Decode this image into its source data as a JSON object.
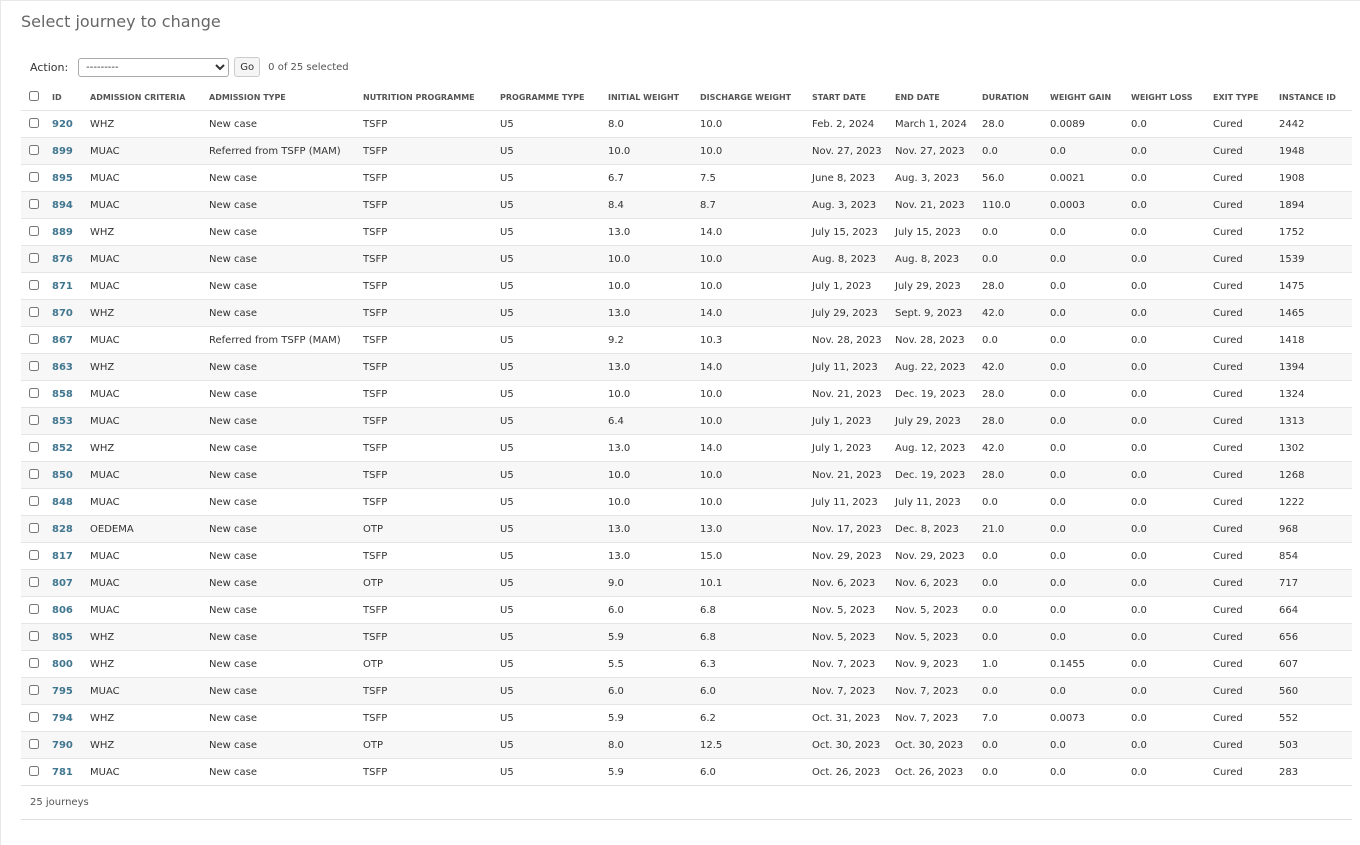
{
  "page": {
    "title": "Select journey to change"
  },
  "actions": {
    "label": "Action:",
    "select_value": "---------",
    "go_label": "Go",
    "counter": "0 of 25 selected"
  },
  "table": {
    "columns": [
      "ID",
      "Admission criteria",
      "Admission type",
      "Nutrition programme",
      "Programme type",
      "Initial weight",
      "Discharge weight",
      "Start date",
      "End date",
      "Duration",
      "Weight gain",
      "Weight loss",
      "Exit type",
      "Instance ID"
    ],
    "rows": [
      [
        "920",
        "WHZ",
        "New case",
        "TSFP",
        "U5",
        "8.0",
        "10.0",
        "Feb. 2, 2024",
        "March 1, 2024",
        "28.0",
        "0.0089",
        "0.0",
        "Cured",
        "2442"
      ],
      [
        "899",
        "MUAC",
        "Referred from TSFP (MAM)",
        "TSFP",
        "U5",
        "10.0",
        "10.0",
        "Nov. 27, 2023",
        "Nov. 27, 2023",
        "0.0",
        "0.0",
        "0.0",
        "Cured",
        "1948"
      ],
      [
        "895",
        "MUAC",
        "New case",
        "TSFP",
        "U5",
        "6.7",
        "7.5",
        "June 8, 2023",
        "Aug. 3, 2023",
        "56.0",
        "0.0021",
        "0.0",
        "Cured",
        "1908"
      ],
      [
        "894",
        "MUAC",
        "New case",
        "TSFP",
        "U5",
        "8.4",
        "8.7",
        "Aug. 3, 2023",
        "Nov. 21, 2023",
        "110.0",
        "0.0003",
        "0.0",
        "Cured",
        "1894"
      ],
      [
        "889",
        "WHZ",
        "New case",
        "TSFP",
        "U5",
        "13.0",
        "14.0",
        "July 15, 2023",
        "July 15, 2023",
        "0.0",
        "0.0",
        "0.0",
        "Cured",
        "1752"
      ],
      [
        "876",
        "MUAC",
        "New case",
        "TSFP",
        "U5",
        "10.0",
        "10.0",
        "Aug. 8, 2023",
        "Aug. 8, 2023",
        "0.0",
        "0.0",
        "0.0",
        "Cured",
        "1539"
      ],
      [
        "871",
        "MUAC",
        "New case",
        "TSFP",
        "U5",
        "10.0",
        "10.0",
        "July 1, 2023",
        "July 29, 2023",
        "28.0",
        "0.0",
        "0.0",
        "Cured",
        "1475"
      ],
      [
        "870",
        "WHZ",
        "New case",
        "TSFP",
        "U5",
        "13.0",
        "14.0",
        "July 29, 2023",
        "Sept. 9, 2023",
        "42.0",
        "0.0",
        "0.0",
        "Cured",
        "1465"
      ],
      [
        "867",
        "MUAC",
        "Referred from TSFP (MAM)",
        "TSFP",
        "U5",
        "9.2",
        "10.3",
        "Nov. 28, 2023",
        "Nov. 28, 2023",
        "0.0",
        "0.0",
        "0.0",
        "Cured",
        "1418"
      ],
      [
        "863",
        "WHZ",
        "New case",
        "TSFP",
        "U5",
        "13.0",
        "14.0",
        "July 11, 2023",
        "Aug. 22, 2023",
        "42.0",
        "0.0",
        "0.0",
        "Cured",
        "1394"
      ],
      [
        "858",
        "MUAC",
        "New case",
        "TSFP",
        "U5",
        "10.0",
        "10.0",
        "Nov. 21, 2023",
        "Dec. 19, 2023",
        "28.0",
        "0.0",
        "0.0",
        "Cured",
        "1324"
      ],
      [
        "853",
        "MUAC",
        "New case",
        "TSFP",
        "U5",
        "6.4",
        "10.0",
        "July 1, 2023",
        "July 29, 2023",
        "28.0",
        "0.0",
        "0.0",
        "Cured",
        "1313"
      ],
      [
        "852",
        "WHZ",
        "New case",
        "TSFP",
        "U5",
        "13.0",
        "14.0",
        "July 1, 2023",
        "Aug. 12, 2023",
        "42.0",
        "0.0",
        "0.0",
        "Cured",
        "1302"
      ],
      [
        "850",
        "MUAC",
        "New case",
        "TSFP",
        "U5",
        "10.0",
        "10.0",
        "Nov. 21, 2023",
        "Dec. 19, 2023",
        "28.0",
        "0.0",
        "0.0",
        "Cured",
        "1268"
      ],
      [
        "848",
        "MUAC",
        "New case",
        "TSFP",
        "U5",
        "10.0",
        "10.0",
        "July 11, 2023",
        "July 11, 2023",
        "0.0",
        "0.0",
        "0.0",
        "Cured",
        "1222"
      ],
      [
        "828",
        "OEDEMA",
        "New case",
        "OTP",
        "U5",
        "13.0",
        "13.0",
        "Nov. 17, 2023",
        "Dec. 8, 2023",
        "21.0",
        "0.0",
        "0.0",
        "Cured",
        "968"
      ],
      [
        "817",
        "MUAC",
        "New case",
        "TSFP",
        "U5",
        "13.0",
        "15.0",
        "Nov. 29, 2023",
        "Nov. 29, 2023",
        "0.0",
        "0.0",
        "0.0",
        "Cured",
        "854"
      ],
      [
        "807",
        "MUAC",
        "New case",
        "OTP",
        "U5",
        "9.0",
        "10.1",
        "Nov. 6, 2023",
        "Nov. 6, 2023",
        "0.0",
        "0.0",
        "0.0",
        "Cured",
        "717"
      ],
      [
        "806",
        "MUAC",
        "New case",
        "TSFP",
        "U5",
        "6.0",
        "6.8",
        "Nov. 5, 2023",
        "Nov. 5, 2023",
        "0.0",
        "0.0",
        "0.0",
        "Cured",
        "664"
      ],
      [
        "805",
        "WHZ",
        "New case",
        "TSFP",
        "U5",
        "5.9",
        "6.8",
        "Nov. 5, 2023",
        "Nov. 5, 2023",
        "0.0",
        "0.0",
        "0.0",
        "Cured",
        "656"
      ],
      [
        "800",
        "WHZ",
        "New case",
        "OTP",
        "U5",
        "5.5",
        "6.3",
        "Nov. 7, 2023",
        "Nov. 9, 2023",
        "1.0",
        "0.1455",
        "0.0",
        "Cured",
        "607"
      ],
      [
        "795",
        "MUAC",
        "New case",
        "TSFP",
        "U5",
        "6.0",
        "6.0",
        "Nov. 7, 2023",
        "Nov. 7, 2023",
        "0.0",
        "0.0",
        "0.0",
        "Cured",
        "560"
      ],
      [
        "794",
        "WHZ",
        "New case",
        "TSFP",
        "U5",
        "5.9",
        "6.2",
        "Oct. 31, 2023",
        "Nov. 7, 2023",
        "7.0",
        "0.0073",
        "0.0",
        "Cured",
        "552"
      ],
      [
        "790",
        "WHZ",
        "New case",
        "OTP",
        "U5",
        "8.0",
        "12.5",
        "Oct. 30, 2023",
        "Oct. 30, 2023",
        "0.0",
        "0.0",
        "0.0",
        "Cured",
        "503"
      ],
      [
        "781",
        "MUAC",
        "New case",
        "TSFP",
        "U5",
        "5.9",
        "6.0",
        "Oct. 26, 2023",
        "Oct. 26, 2023",
        "0.0",
        "0.0",
        "0.0",
        "Cured",
        "283"
      ]
    ]
  },
  "footer": {
    "count": "25 journeys"
  }
}
